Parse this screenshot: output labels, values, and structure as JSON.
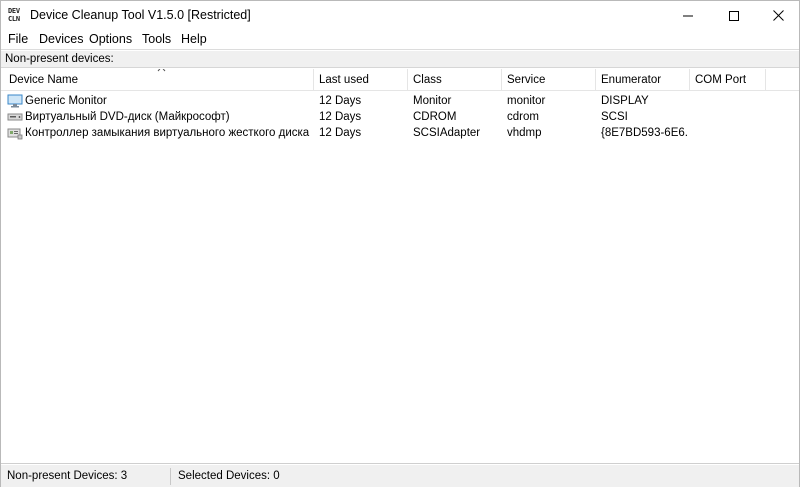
{
  "window": {
    "icon_text_top": "DEV",
    "icon_text_bottom": "CLN",
    "title": "Device Cleanup Tool V1.5.0  [Restricted]"
  },
  "menu": {
    "items": [
      "File",
      "Devices",
      "Options",
      "Tools",
      "Help"
    ]
  },
  "section_label": "Non-present devices:",
  "table": {
    "columns": [
      "Device Name",
      "Last used",
      "Class",
      "Service",
      "Enumerator",
      "COM Port"
    ],
    "sorted_column": "Device Name",
    "rows": [
      {
        "icon": "monitor-icon",
        "name": "Generic Monitor",
        "last_used": "12 Days",
        "class": "Monitor",
        "service": "monitor",
        "enumerator": "DISPLAY",
        "com_port": ""
      },
      {
        "icon": "dvd-drive-icon",
        "name": "Виртуальный DVD-диск (Майкрософт)",
        "last_used": "12 Days",
        "class": "CDROM",
        "service": "cdrom",
        "enumerator": "SCSI",
        "com_port": ""
      },
      {
        "icon": "storage-controller-icon",
        "name": "Контроллер замыкания виртуального жесткого диска на ...",
        "last_used": "12 Days",
        "class": "SCSIAdapter",
        "service": "vhdmp",
        "enumerator": "{8E7BD593-6E6...",
        "com_port": ""
      }
    ]
  },
  "status": {
    "non_present": "Non-present Devices: 3",
    "selected": "Selected Devices: 0"
  }
}
